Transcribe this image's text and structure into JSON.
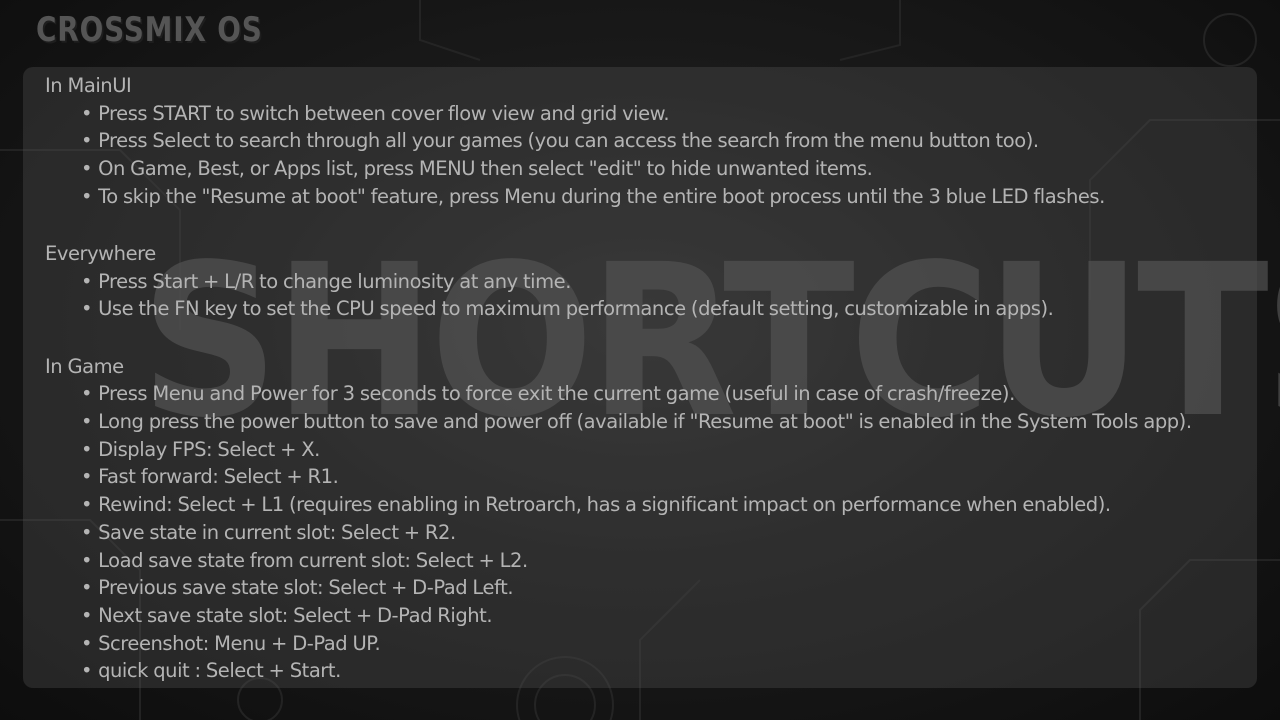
{
  "logo": {
    "text": "CROSSMIX OS"
  },
  "watermark": {
    "text": "SHORTCUTS"
  },
  "sections": [
    {
      "title": "In MainUI",
      "items": [
        "Press START to switch between cover flow view and grid view.",
        "Press Select to search through all your games (you can access the search from the menu button too).",
        "On Game, Best, or Apps list, press MENU then select \"edit\" to hide unwanted items.",
        "To skip the \"Resume at boot\" feature, press Menu during the entire boot process until the 3 blue LED flashes."
      ]
    },
    {
      "title": "Everywhere",
      "items": [
        "Press Start + L/R to change luminosity at any time.",
        "Use the FN key to set the CPU speed to maximum performance (default setting, customizable in apps)."
      ]
    },
    {
      "title": "In Game",
      "items": [
        "Press Menu and Power for 3 seconds to force exit the current game (useful in case of crash/freeze).",
        "Long press the power button to save and power off (available if \"Resume at boot\" is enabled in the System Tools app).",
        "Display FPS: Select + X.",
        "Fast forward: Select + R1.",
        "Rewind: Select + L1 (requires enabling in Retroarch, has a significant impact on performance when enabled).",
        "Save state in current slot: Select + R2.",
        "Load save state from current slot: Select + L2.",
        "Previous save state slot: Select + D-Pad Left.",
        "Next save state slot: Select + D-Pad Right.",
        "Screenshot: Menu + D-Pad UP.",
        "quick quit : Select + Start."
      ]
    }
  ]
}
